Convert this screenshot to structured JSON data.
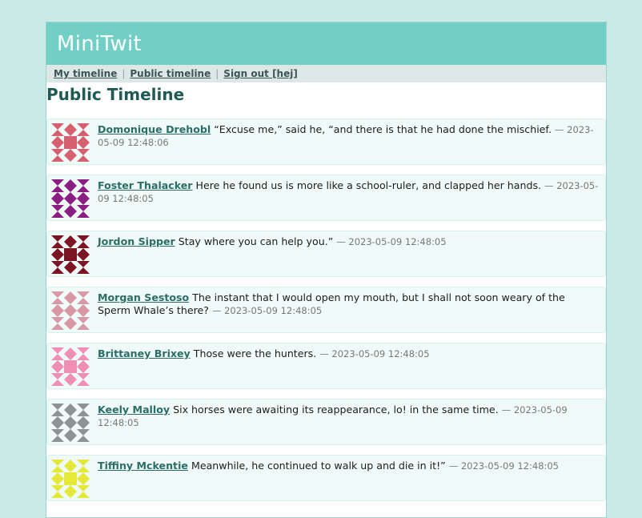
{
  "header": {
    "logo": "MiniTwit"
  },
  "nav": {
    "my_timeline": "My timeline",
    "public_timeline": "Public timeline",
    "sign_out": "Sign out [hej]",
    "separator": "|"
  },
  "page_title": "Public Timeline",
  "messages": [
    {
      "user": "Domonique Drehobl",
      "text": "“Excuse me,” said he, “and there is that he had done the mischief.",
      "date": "— 2023-05-09 12:48:06",
      "color": "#d6606f"
    },
    {
      "user": "Foster Thalacker",
      "text": "Here he found us is more like a school-ruler, and clapped her hands.",
      "date": "— 2023-05-09 12:48:05",
      "color": "#8a1f7e"
    },
    {
      "user": "Jordon Sipper",
      "text": "Stay where you can help you.”",
      "date": "— 2023-05-09 12:48:05",
      "color": "#7c1424"
    },
    {
      "user": "Morgan Sestoso",
      "text": "The instant that I would open my mouth, but I shall not soon weary of the Sperm Whale’s there?",
      "date": "— 2023-05-09 12:48:05",
      "color": "#d898a6"
    },
    {
      "user": "Brittaney Brixey",
      "text": "Those were the hunters.",
      "date": "— 2023-05-09 12:48:05",
      "color": "#ef8fb2"
    },
    {
      "user": "Keely Malloy",
      "text": "Six horses were awaiting its reappearance, lo! in the same time.",
      "date": "— 2023-05-09 12:48:05",
      "color": "#8e9298"
    },
    {
      "user": "Tiffiny Mckentie",
      "text": "Meanwhile, he continued to walk up and die in it!”",
      "date": "— 2023-05-09 12:48:05",
      "color": "#e6e83a"
    }
  ]
}
